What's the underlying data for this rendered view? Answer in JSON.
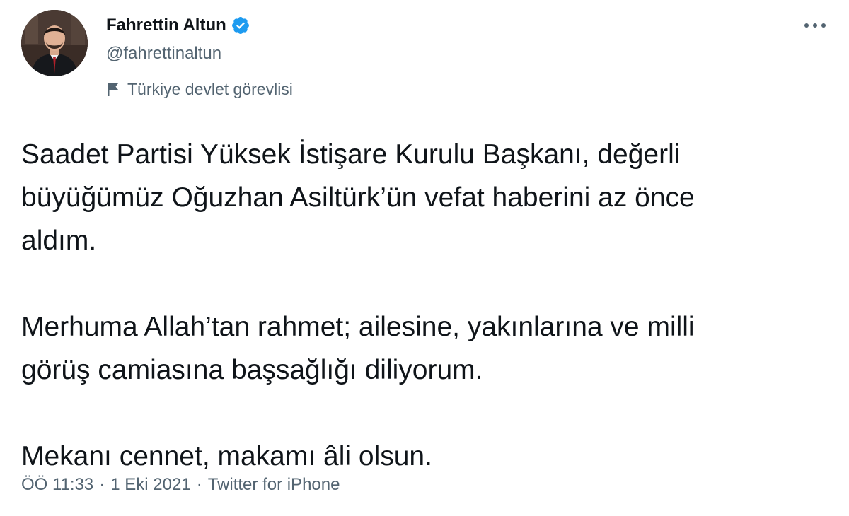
{
  "author": {
    "display_name": "Fahrettin Altun",
    "handle": "@fahrettinaltun",
    "verified_icon": "verified-badge-icon",
    "account_label": "Türkiye devlet görevlisi",
    "label_icon": "flag-icon"
  },
  "tweet": {
    "lines": [
      "Saadet Partisi Yüksek İstişare Kurulu Başkanı, değerli",
      "büyüğümüz Oğuzhan Asiltürk’ün vefat haberini az önce",
      "aldım.",
      "Merhuma Allah’tan rahmet; ailesine, yakınlarına ve milli",
      "görüş camiasına başsağlığı diliyorum.",
      "Mekanı cennet, makamı âli olsun."
    ]
  },
  "meta": {
    "time": "ÖÖ 11:33",
    "separator": "·",
    "date": "1 Eki 2021",
    "source": "Twitter for iPhone"
  },
  "colors": {
    "verified": "#1d9bf0",
    "muted_text": "#536471",
    "main_text": "#0f1419"
  }
}
